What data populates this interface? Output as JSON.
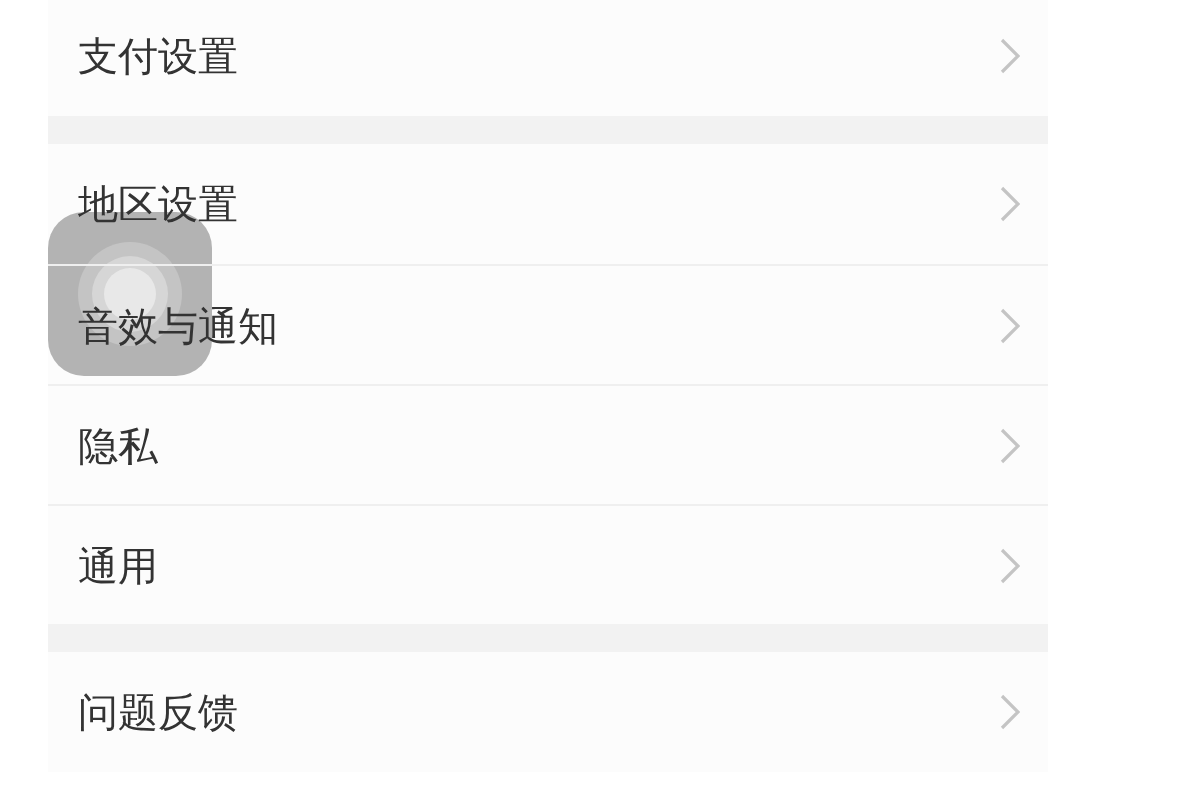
{
  "groups": [
    {
      "items": [
        {
          "label": "支付设置"
        }
      ]
    },
    {
      "items": [
        {
          "label": "地区设置"
        },
        {
          "label": "音效与通知"
        },
        {
          "label": "隐私"
        },
        {
          "label": "通用"
        }
      ]
    },
    {
      "items": [
        {
          "label": "问题反馈"
        }
      ]
    }
  ]
}
